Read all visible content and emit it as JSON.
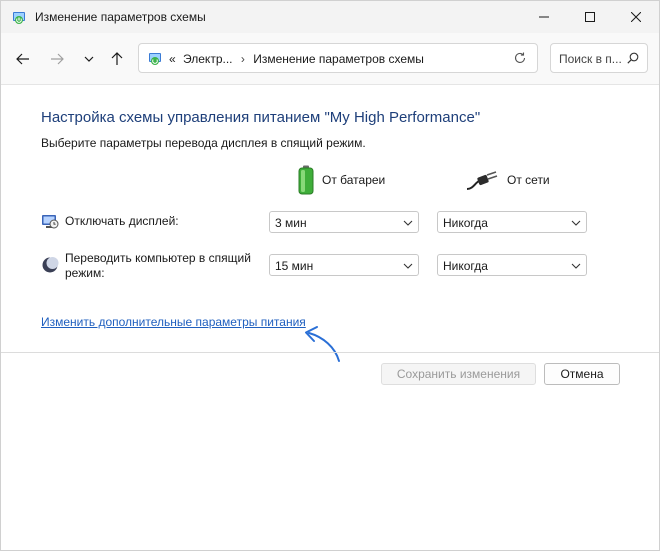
{
  "window": {
    "title": "Изменение параметров схемы",
    "icon": "power-options-icon"
  },
  "nav": {
    "breadcrumb_prefix": "«",
    "breadcrumbs": [
      "Электр...",
      "Изменение параметров схемы"
    ],
    "search_placeholder": "Поиск в п..."
  },
  "content": {
    "heading": "Настройка схемы управления питанием \"My High Performance\"",
    "subheading": "Выберите параметры перевода дисплея в спящий режим.",
    "columns": {
      "battery": "От батареи",
      "ac": "От сети"
    },
    "rows": [
      {
        "label": "Отключать дисплей:",
        "battery": "3 мин",
        "ac": "Никогда"
      },
      {
        "label_line1": "Переводить компьютер в спящий",
        "label_line2": "режим:",
        "battery": "15 мин",
        "ac": "Никогда"
      }
    ],
    "advanced_link": "Изменить дополнительные параметры питания"
  },
  "buttons": {
    "save": "Сохранить изменения",
    "cancel": "Отмена"
  },
  "colors": {
    "heading": "#1e3f7a",
    "link": "#1f5fbf",
    "arrow": "#2a6fd6"
  }
}
